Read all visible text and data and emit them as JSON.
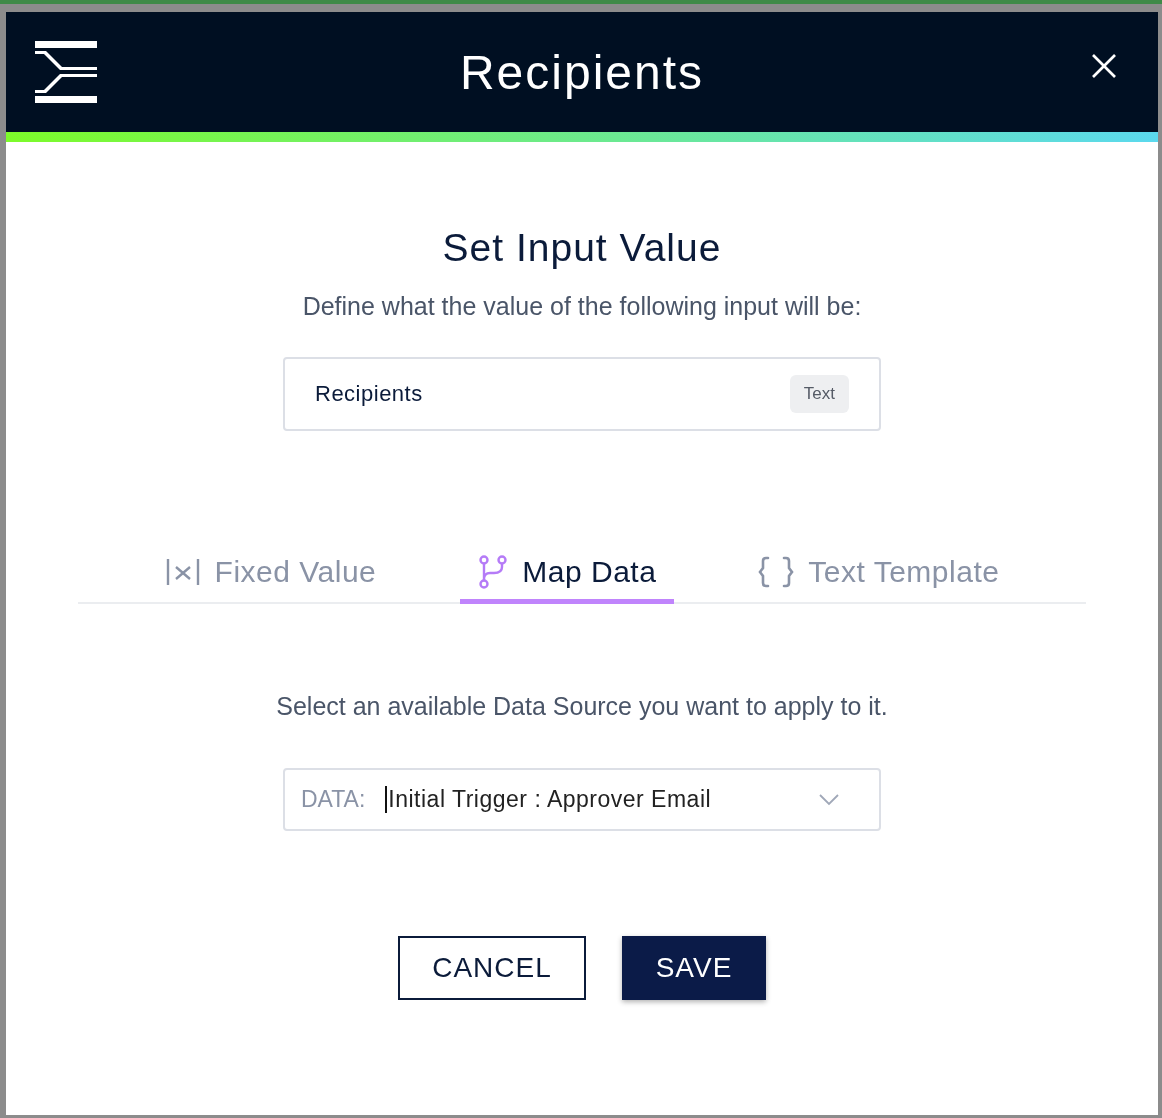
{
  "window": {
    "title": "Recipients"
  },
  "heading": "Set Input Value",
  "description": "Define what the value of the following input will be:",
  "input": {
    "name": "Recipients",
    "type_badge": "Text"
  },
  "tabs": [
    {
      "label": "Fixed Value",
      "kind": "fixed",
      "selected": false
    },
    {
      "label": "Map Data",
      "kind": "map",
      "selected": true
    },
    {
      "label": "Text Template",
      "kind": "template",
      "selected": false
    }
  ],
  "instruction": "Select an available Data Source you want to apply to it.",
  "data_select": {
    "label": "DATA:",
    "value": "Initial Trigger : Approver Email",
    "focused": true
  },
  "buttons": [
    {
      "label": "CANCEL",
      "kind": "secondary"
    },
    {
      "label": "SAVE",
      "kind": "primary"
    }
  ]
}
